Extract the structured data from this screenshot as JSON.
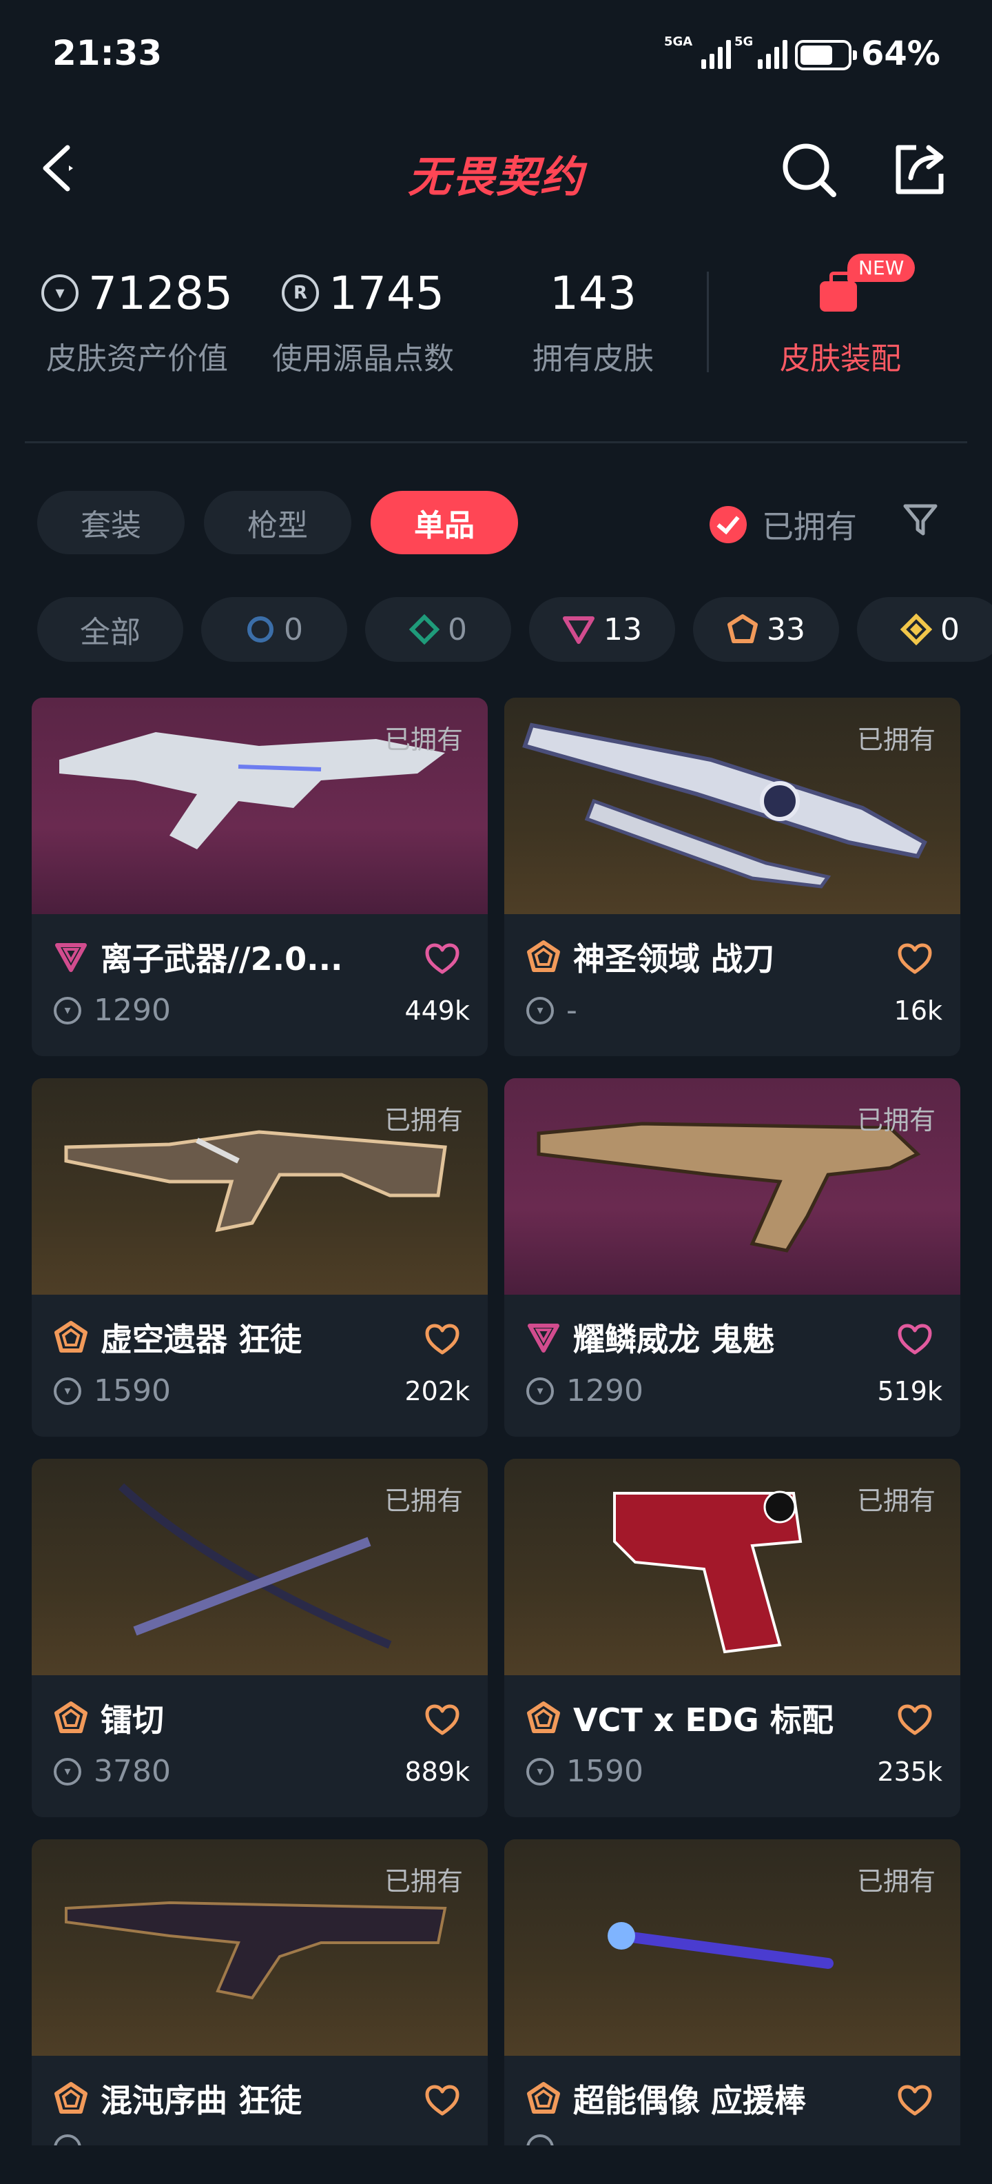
{
  "status_bar": {
    "time": "21:33",
    "net1": "5GA",
    "net2": "5G",
    "battery": "64%"
  },
  "header": {
    "title": "无畏契约"
  },
  "stats": [
    {
      "value": "71285",
      "label": "皮肤资产价值",
      "icon": "vp-coin-icon"
    },
    {
      "value": "1745",
      "label": "使用源晶点数",
      "icon": "radianite-icon"
    },
    {
      "value": "143",
      "label": "拥有皮肤"
    }
  ],
  "loadout": {
    "label": "皮肤装配",
    "badge": "NEW"
  },
  "tabs": [
    {
      "label": "套装",
      "active": false
    },
    {
      "label": "枪型",
      "active": false
    },
    {
      "label": "单品",
      "active": true
    }
  ],
  "owned_filter": {
    "label": "已拥有",
    "checked": true
  },
  "rarity_chips": [
    {
      "label": "全部"
    },
    {
      "count": "0",
      "tier": "select",
      "color": "#3b6ea8"
    },
    {
      "count": "0",
      "tier": "deluxe",
      "color": "#1f9b7a"
    },
    {
      "count": "13",
      "tier": "premium",
      "color": "#d24c8e"
    },
    {
      "count": "33",
      "tier": "exclusive",
      "color": "#f29a5a"
    },
    {
      "count": "0",
      "tier": "ultra",
      "color": "#f1c64a"
    }
  ],
  "cards": [
    {
      "name": "离子武器//2.0...",
      "tier": "premium",
      "owned": "已拥有",
      "price": "1290",
      "likes": "449k",
      "bg": "pink"
    },
    {
      "name": "神圣领域 战刀",
      "tier": "exclusive",
      "owned": "已拥有",
      "price": "-",
      "likes": "16k",
      "bg": "gold"
    },
    {
      "name": "虚空遗器 狂徒",
      "tier": "exclusive",
      "owned": "已拥有",
      "price": "1590",
      "likes": "202k",
      "bg": "gold"
    },
    {
      "name": "耀鳞威龙 鬼魅",
      "tier": "premium",
      "owned": "已拥有",
      "price": "1290",
      "likes": "519k",
      "bg": "pink"
    },
    {
      "name": "镭切",
      "tier": "exclusive",
      "owned": "已拥有",
      "price": "3780",
      "likes": "889k",
      "bg": "gold"
    },
    {
      "name": "VCT x EDG 标配",
      "tier": "exclusive",
      "owned": "已拥有",
      "price": "1590",
      "likes": "235k",
      "bg": "gold"
    },
    {
      "name": "混沌序曲 狂徒",
      "tier": "exclusive",
      "owned": "已拥有",
      "price": "",
      "likes": "",
      "bg": "gold"
    },
    {
      "name": "超能偶像 应援棒",
      "tier": "exclusive",
      "owned": "已拥有",
      "price": "",
      "likes": "",
      "bg": "gold"
    }
  ]
}
